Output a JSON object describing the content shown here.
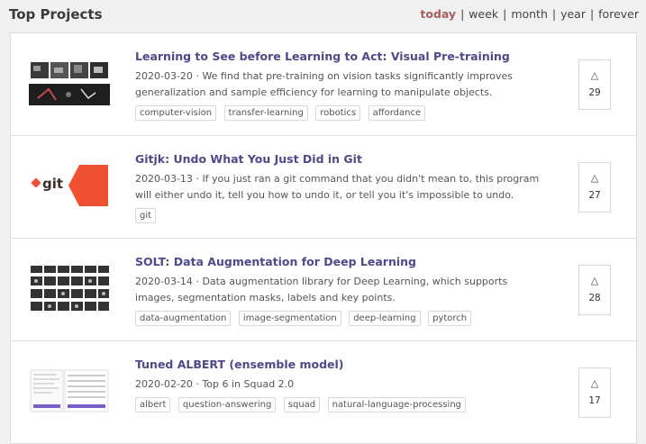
{
  "header": {
    "title": "Top Projects",
    "periods": [
      "today",
      "week",
      "month",
      "year",
      "forever"
    ],
    "selected_period": "today",
    "separator": "|"
  },
  "projects": [
    {
      "title": "Learning to See before Learning to Act: Visual Pre-training",
      "date": "2020-03-20",
      "description": "We find that pre-training on vision tasks significantly improves generalization and sample efficiency for learning to manipulate objects.",
      "tags": [
        "computer-vision",
        "transfer-learning",
        "robotics",
        "affordance"
      ],
      "votes": "29"
    },
    {
      "title": "Gitjk: Undo What You Just Did in Git",
      "date": "2020-03-13",
      "description": "If you just ran a git command that you didn't mean to, this program will either undo it, tell you how to undo it, or tell you it's impossible to undo.",
      "tags": [
        "git"
      ],
      "votes": "27",
      "thumb_text": "git"
    },
    {
      "title": "SOLT: Data Augmentation for Deep Learning",
      "date": "2020-03-14",
      "description": "Data augmentation library for Deep Learning, which supports images, segmentation masks, labels and key points.",
      "tags": [
        "data-augmentation",
        "image-segmentation",
        "deep-learning",
        "pytorch"
      ],
      "votes": "28"
    },
    {
      "title": "Tuned ALBERT (ensemble model)",
      "date": "2020-02-20",
      "description": "Top 6 in Squad 2.0",
      "tags": [
        "albert",
        "question-answering",
        "squad",
        "natural-language-processing"
      ],
      "votes": "17"
    }
  ],
  "date_separator": "·",
  "vote_icon": "triangle-up-icon",
  "colors": {
    "title": "#4e4a8a",
    "selected_period": "#a85d5d",
    "git_brand": "#f05133"
  }
}
